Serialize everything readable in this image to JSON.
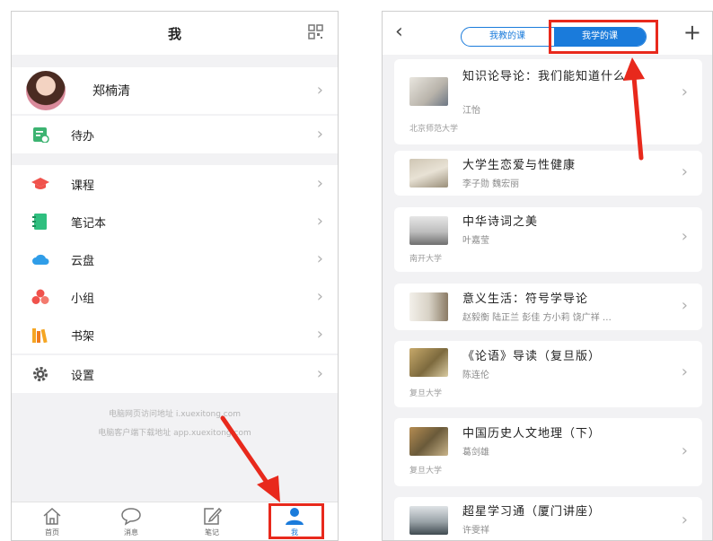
{
  "left": {
    "header_title": "我",
    "qr_icon": "qr-code-icon",
    "profile_name": "郑楠清",
    "todo": {
      "label": "待办",
      "icon": "todo-icon",
      "color": "#3cb371"
    },
    "menu": [
      {
        "label": "课程",
        "icon": "graduation-cap-icon",
        "color": "#f0524c"
      },
      {
        "label": "笔记本",
        "icon": "notebook-icon",
        "color": "#2fbf7f"
      },
      {
        "label": "云盘",
        "icon": "cloud-icon",
        "color": "#2f9de8"
      },
      {
        "label": "小组",
        "icon": "group-icon",
        "color": "#f0524c"
      },
      {
        "label": "书架",
        "icon": "bookshelf-icon",
        "color": "#f5a623"
      }
    ],
    "settings": {
      "label": "设置",
      "icon": "gear-icon"
    },
    "footer_lines": [
      "电脑网页访问地址 i.xuexitong.com",
      "电脑客户端下载地址 app.xuexitong.com"
    ],
    "tabs": [
      {
        "label": "首页",
        "icon": "home-icon"
      },
      {
        "label": "消息",
        "icon": "message-icon"
      },
      {
        "label": "笔记",
        "icon": "note-edit-icon"
      },
      {
        "label": "我",
        "icon": "user-icon",
        "active": true
      }
    ]
  },
  "right": {
    "back_icon": "back-chevron-icon",
    "add_icon": "plus-icon",
    "segments": [
      "我教的课",
      "我学的课"
    ],
    "active_segment": 1,
    "courses": [
      {
        "title": "知识论导论：我们能知道什么？",
        "author": "江怡",
        "university": "北京师范大学"
      },
      {
        "title": "大学生恋爱与性健康",
        "author": "李子勋 魏宏丽",
        "university": ""
      },
      {
        "title": "中华诗词之美",
        "author": "叶嘉莹",
        "university": "南开大学"
      },
      {
        "title": "意义生活：符号学导论",
        "author": "赵毅衡 陆正兰 彭佳 方小莉 饶广祥 …",
        "university": ""
      },
      {
        "title": "《论语》导读（复旦版）",
        "author": "陈连伦",
        "university": "复旦大学"
      },
      {
        "title": "中国历史人文地理（下）",
        "author": "葛剑雄",
        "university": "复旦大学"
      },
      {
        "title": "超星学习通（厦门讲座）",
        "author": "许雯祥",
        "university": ""
      }
    ]
  },
  "colors": {
    "accent": "#1a7bdb",
    "highlight": "#e8291c"
  }
}
